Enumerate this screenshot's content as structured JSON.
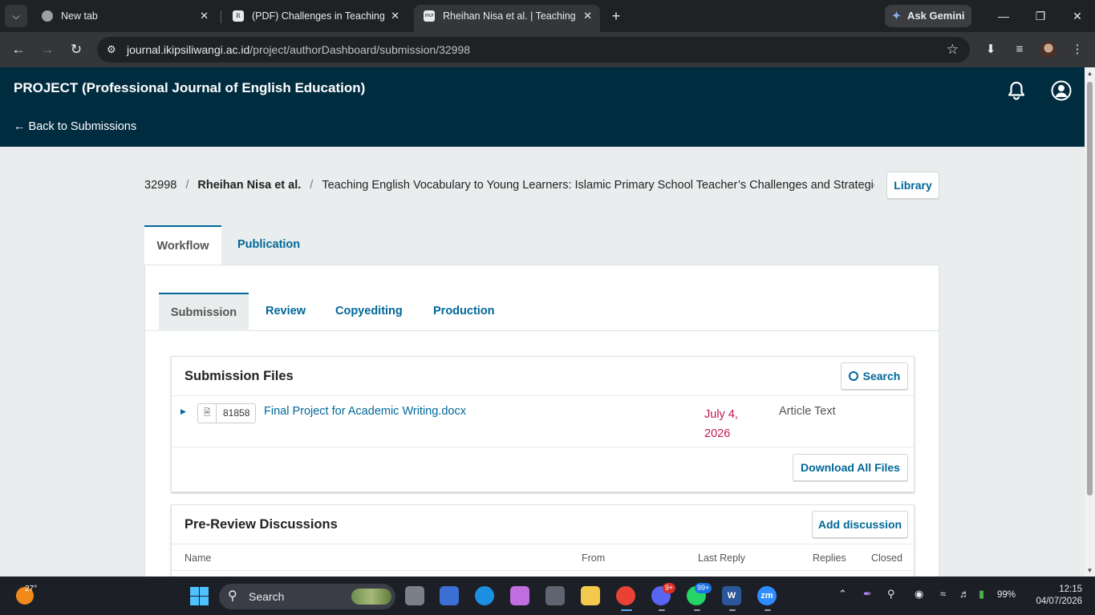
{
  "browser": {
    "tabs": [
      {
        "title": "New tab",
        "favicon": "chrome-icon"
      },
      {
        "title": "(PDF) Challenges in Teaching En",
        "favicon": "R"
      },
      {
        "title": "Rheihan Nisa et al. | Teaching En",
        "favicon": "PKP"
      }
    ],
    "ask_gemini": "Ask Gemini",
    "url_host": "journal.ikipsiliwangi.ac.id",
    "url_path": "/project/authorDashboard/submission/32998"
  },
  "header": {
    "journal_title": "PROJECT (Professional Journal of English Education)",
    "back_link": "← Back to Submissions"
  },
  "breadcrumb": {
    "id": "32998",
    "sep": "/",
    "author": "Rheihan Nisa et al.",
    "title": "Teaching English Vocabulary to Young Learners: Islamic Primary School Teacher’s Challenges and Strategies"
  },
  "library_label": "Library",
  "main_tabs": [
    "Workflow",
    "Publication"
  ],
  "sub_tabs": [
    "Submission",
    "Review",
    "Copyediting",
    "Production"
  ],
  "submission_files": {
    "title": "Submission Files",
    "search_label": "Search",
    "file": {
      "id": "81858",
      "name": "Final Project for Academic Writing.docx",
      "date_line1": "July 4,",
      "date_line2": "2026",
      "type": "Article Text"
    },
    "download_label": "Download All Files"
  },
  "discussions": {
    "title": "Pre-Review Discussions",
    "add_label": "Add discussion",
    "columns": [
      "Name",
      "From",
      "Last Reply",
      "Replies",
      "Closed"
    ]
  },
  "taskbar": {
    "temperature": "27°",
    "search_label": "Search",
    "discord_badge": "9+",
    "whatsapp_badge": "99+",
    "battery": "99%",
    "time": "12:15",
    "date": "04/07/2026"
  },
  "colors": {
    "header_bg": "#002c40",
    "link": "#006798",
    "date": "#c0164e",
    "page_bg": "#eaedee"
  }
}
